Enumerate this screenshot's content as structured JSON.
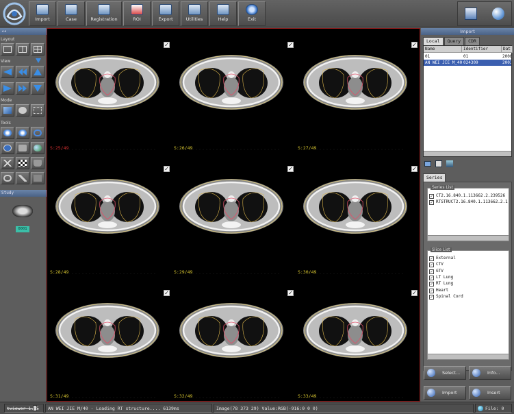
{
  "toolbar": {
    "buttons": [
      {
        "label": "Import",
        "icon": "import-icon"
      },
      {
        "label": "Case",
        "icon": "case-icon"
      },
      {
        "label": "Registration",
        "icon": "registration-icon"
      },
      {
        "label": "ROI",
        "icon": "roi-icon"
      },
      {
        "label": "Export",
        "icon": "export-icon"
      },
      {
        "label": "Utilities",
        "icon": "utilities-icon"
      },
      {
        "label": "Help",
        "icon": "help-icon"
      },
      {
        "label": "Exit",
        "icon": "power-icon"
      }
    ]
  },
  "left_panel": {
    "layout_label": "Layout",
    "view_label": "View",
    "mode_label": "Mode",
    "tools_label": "Tools",
    "study_label": "Study",
    "study_badge": "0001"
  },
  "viewer": {
    "cells": [
      {
        "slice": "S:25/49",
        "checked": true,
        "current": true
      },
      {
        "slice": "S:26/49",
        "checked": true,
        "current": false
      },
      {
        "slice": "S:27/49",
        "checked": true,
        "current": false
      },
      {
        "slice": "S:28/49",
        "checked": true,
        "current": false
      },
      {
        "slice": "S:29/49",
        "checked": true,
        "current": false
      },
      {
        "slice": "S:30/49",
        "checked": true,
        "current": false
      },
      {
        "slice": "S:31/49",
        "checked": true,
        "current": false
      },
      {
        "slice": "S:32/49",
        "checked": true,
        "current": false
      },
      {
        "slice": "S:33/49",
        "checked": true,
        "current": false
      }
    ]
  },
  "import_panel": {
    "title": "Import",
    "tabs": [
      "Local",
      "Query",
      "CDR"
    ],
    "active_tab": "Local",
    "columns": [
      "Name",
      "Identifier",
      "Dat"
    ],
    "rows": [
      {
        "name": "01",
        "identifier": "01",
        "date": "2006",
        "selected": false
      },
      {
        "name": "AN WEI JIE M_40",
        "identifier": "024309",
        "date": "2003",
        "selected": true
      }
    ]
  },
  "series_panel": {
    "tab": "Series",
    "series_list_label": "Series List",
    "series": [
      {
        "label": "CT2.16.840.1.113662.2.239526",
        "checked": true
      },
      {
        "label": "RTSTRUCT2.16.840.1.113662.2.1",
        "checked": true
      }
    ],
    "slice_list_label": "Slice List",
    "structures": [
      {
        "label": "External",
        "checked": true
      },
      {
        "label": "CTV",
        "checked": true
      },
      {
        "label": "GTV",
        "checked": true
      },
      {
        "label": "LT Lung",
        "checked": true
      },
      {
        "label": "RT Lung",
        "checked": true
      },
      {
        "label": "Heart",
        "checked": true
      },
      {
        "label": "Spinal Cord",
        "checked": true
      }
    ],
    "select_button": "Select...",
    "info_button": "Info...",
    "import_button": "Import",
    "insert_button": "Insert"
  },
  "status_bar": {
    "version": "tviewer 1.15",
    "message": "AN WEI JIE M/40 - Loading RT structure.... 6139ms",
    "image_info": "Image(78 373 29) Value:RGB(-916:0 0 0)",
    "file_count": "File: 0"
  }
}
